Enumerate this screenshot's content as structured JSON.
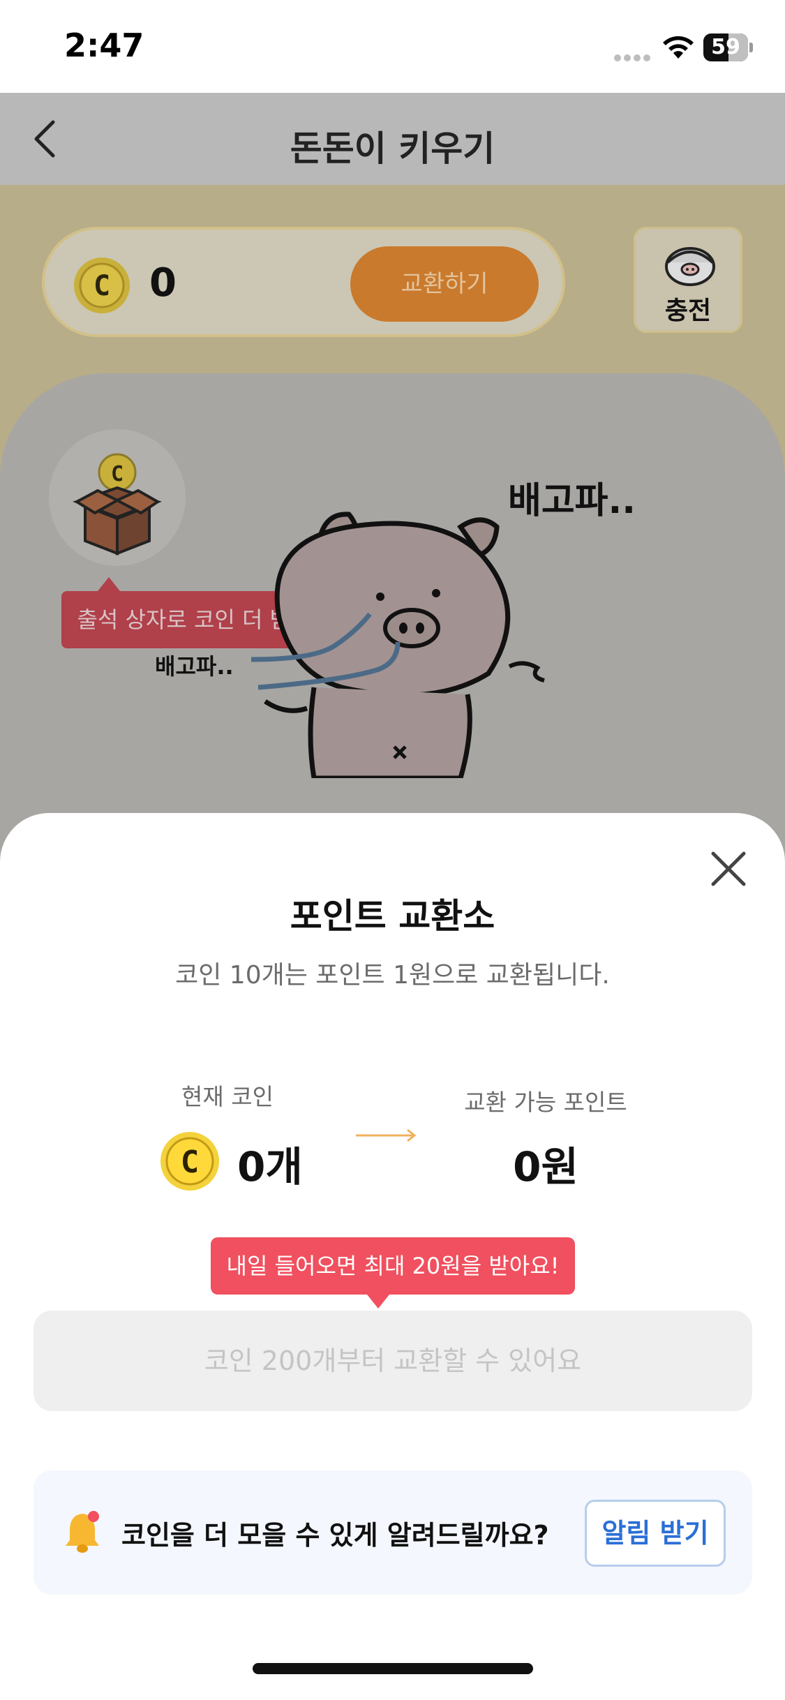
{
  "status_bar": {
    "time": "2:47",
    "battery": "59"
  },
  "header": {
    "title": "돈돈이 키우기"
  },
  "coin_bar": {
    "count": "0",
    "exchange_label": "교환하기",
    "charge_label": "충전"
  },
  "stage": {
    "gift_tooltip": "출석 상자로 코인 더 받기",
    "speech_large": "배고파..",
    "speech_small": "배고파.."
  },
  "sheet": {
    "title": "포인트 교환소",
    "subtitle": "코인 10개는 포인트 1원으로 교환됩니다.",
    "current_coin_label": "현재 코인",
    "current_coin_value": "0개",
    "exchangeable_label": "교환 가능 포인트",
    "exchangeable_value": "0원",
    "promo_tooltip": "내일 들어오면 최대 20원을 받아요!",
    "disabled_button": "코인 200개부터 교환할 수 있어요",
    "notify_text": "코인을 더 모을 수 있게 알려드릴까요?",
    "notify_button": "알림 받기"
  },
  "colors": {
    "accent_orange": "#c97a2d",
    "promo_red": "#f0505f",
    "link_blue": "#2a6fd6"
  },
  "icons": [
    "back-icon",
    "coin-icon",
    "piggy-icon",
    "gift-box-icon",
    "close-icon",
    "arrow-right-icon",
    "bell-icon",
    "wifi-icon",
    "battery-icon"
  ]
}
